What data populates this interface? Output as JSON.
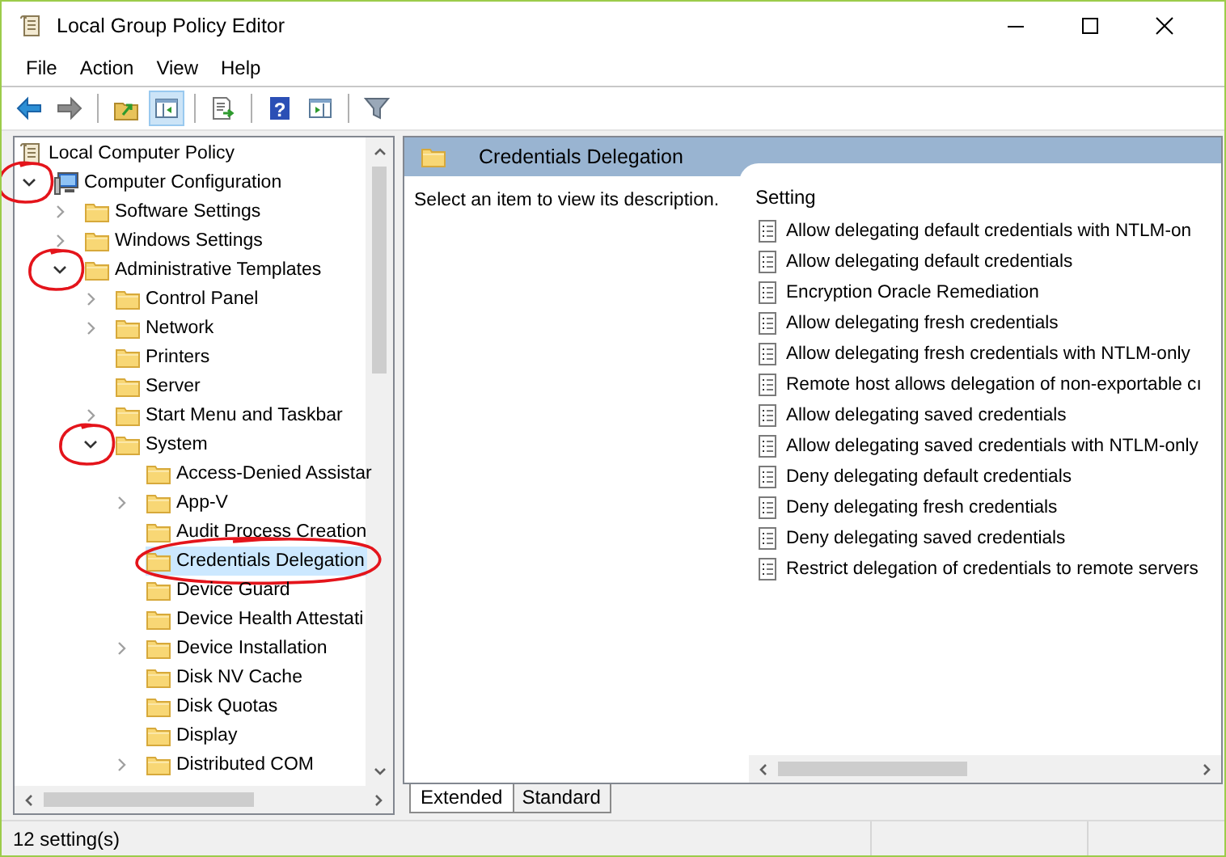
{
  "window": {
    "title": "Local Group Policy Editor"
  },
  "menu": [
    "File",
    "Action",
    "View",
    "Help"
  ],
  "toolbar": [
    {
      "kind": "back",
      "disabled": false,
      "pressed": false
    },
    {
      "kind": "forward",
      "disabled": true,
      "pressed": false
    },
    {
      "kind": "separator"
    },
    {
      "kind": "up",
      "pressed": false
    },
    {
      "kind": "tree-toggle",
      "pressed": true
    },
    {
      "kind": "separator"
    },
    {
      "kind": "export",
      "pressed": false
    },
    {
      "kind": "separator"
    },
    {
      "kind": "help",
      "glyph": "?",
      "pressed": false
    },
    {
      "kind": "action-pane",
      "pressed": false
    },
    {
      "kind": "separator"
    },
    {
      "kind": "filter",
      "pressed": false
    }
  ],
  "tree": {
    "items": [
      {
        "label": "Local Computer Policy",
        "kind": "policy",
        "selected": false,
        "children": [
          {
            "label": "Computer Configuration",
            "kind": "computer",
            "selected": false,
            "expanded": true,
            "circled": true,
            "children": [
              {
                "label": "Software Settings",
                "kind": "folder",
                "selected": false,
                "expanded": false
              },
              {
                "label": "Windows Settings",
                "kind": "folder",
                "selected": false,
                "expanded": false
              },
              {
                "label": "Administrative Templates",
                "kind": "folder",
                "selected": false,
                "expanded": true,
                "circled": true,
                "children": [
                  {
                    "label": "Control Panel",
                    "kind": "folder",
                    "selected": false,
                    "expanded": false
                  },
                  {
                    "label": "Network",
                    "kind": "folder",
                    "selected": false,
                    "expanded": false
                  },
                  {
                    "label": "Printers",
                    "kind": "folder",
                    "selected": false
                  },
                  {
                    "label": "Server",
                    "kind": "folder",
                    "selected": false
                  },
                  {
                    "label": "Start Menu and Taskbar",
                    "kind": "folder",
                    "selected": false,
                    "expanded": false
                  },
                  {
                    "label": "System",
                    "kind": "folder",
                    "selected": false,
                    "expanded": true,
                    "circled": true,
                    "children": [
                      {
                        "label": "Access-Denied Assistar",
                        "kind": "folder",
                        "selected": false
                      },
                      {
                        "label": "App-V",
                        "kind": "folder",
                        "selected": false,
                        "expanded": false
                      },
                      {
                        "label": "Audit Process Creation",
                        "kind": "folder",
                        "selected": false
                      },
                      {
                        "label": "Credentials Delegation",
                        "kind": "folder",
                        "selected": true,
                        "circled": true
                      },
                      {
                        "label": "Device Guard",
                        "kind": "folder",
                        "selected": false
                      },
                      {
                        "label": "Device Health Attestati",
                        "kind": "folder",
                        "selected": false
                      },
                      {
                        "label": "Device Installation",
                        "kind": "folder",
                        "selected": false,
                        "expanded": false
                      },
                      {
                        "label": "Disk NV Cache",
                        "kind": "folder",
                        "selected": false
                      },
                      {
                        "label": "Disk Quotas",
                        "kind": "folder",
                        "selected": false
                      },
                      {
                        "label": "Display",
                        "kind": "folder",
                        "selected": false
                      },
                      {
                        "label": "Distributed COM",
                        "kind": "folder",
                        "selected": false,
                        "expanded": false
                      }
                    ]
                  }
                ]
              }
            ]
          }
        ]
      }
    ]
  },
  "details": {
    "title": "Credentials Delegation",
    "description": "Select an item to view its description.",
    "column": "Setting",
    "rows": [
      {
        "name": "Allow delegating default credentials with NTLM-on",
        "selected": false
      },
      {
        "name": "Allow delegating default credentials",
        "selected": false
      },
      {
        "name": "Encryption Oracle Remediation",
        "selected": false
      },
      {
        "name": "Allow delegating fresh credentials",
        "selected": false
      },
      {
        "name": "Allow delegating fresh credentials with NTLM-only",
        "selected": false
      },
      {
        "name": "Remote host allows delegation of non-exportable cı",
        "selected": false
      },
      {
        "name": "Allow delegating saved credentials",
        "selected": false
      },
      {
        "name": "Allow delegating saved credentials with NTLM-only",
        "selected": false
      },
      {
        "name": "Deny delegating default credentials",
        "selected": false
      },
      {
        "name": "Deny delegating fresh credentials",
        "selected": false
      },
      {
        "name": "Deny delegating saved credentials",
        "selected": false
      },
      {
        "name": "Restrict delegation of credentials to remote servers",
        "selected": false
      }
    ],
    "tabs": [
      {
        "label": "Extended",
        "selected": true
      },
      {
        "label": "Standard",
        "selected": false
      }
    ]
  },
  "status_bar": {
    "text": "12 setting(s)"
  }
}
